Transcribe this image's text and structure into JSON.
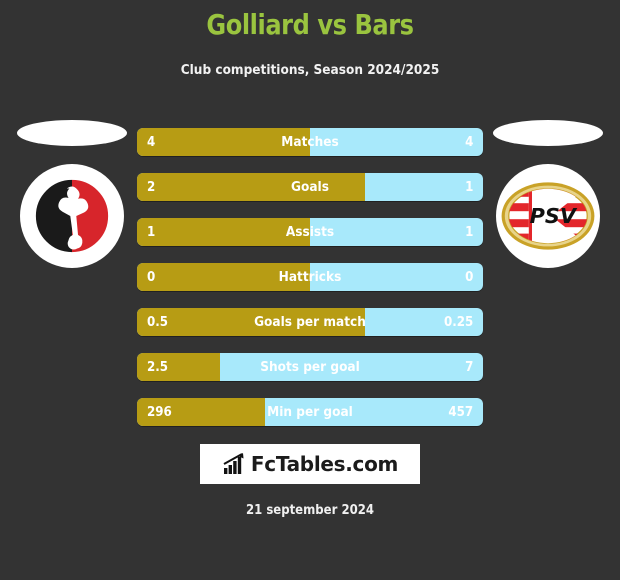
{
  "header": {
    "title": "Golliard vs Bars",
    "subtitle": "Club competitions, Season 2024/2025",
    "title_color": "#9ac43f"
  },
  "teams": {
    "home": {
      "badge_icon": "club-badge-red-black-icon"
    },
    "away": {
      "badge_icon": "psv-badge-icon",
      "badge_text": "PSV"
    }
  },
  "colors": {
    "home_bar": "#b79c14",
    "away_bar": "#a8e9fb",
    "background": "#333333"
  },
  "footer": {
    "logo_text": "FcTables.com",
    "logo_icon": "bar-chart-arrow-icon",
    "date": "21 september 2024"
  },
  "chart_data": {
    "type": "bar",
    "title": "Golliard vs Bars",
    "subtitle": "Club competitions, Season 2024/2025",
    "orientation": "horizontal-diverging",
    "series": [
      {
        "name": "Golliard",
        "color": "#b79c14"
      },
      {
        "name": "Bars",
        "color": "#a8e9fb"
      }
    ],
    "categories": [
      "Matches",
      "Goals",
      "Assists",
      "Hattricks",
      "Goals per match",
      "Shots per goal",
      "Min per goal"
    ],
    "rows": [
      {
        "label": "Matches",
        "home": "4",
        "away": "4",
        "home_pct": 50
      },
      {
        "label": "Goals",
        "home": "2",
        "away": "1",
        "home_pct": 66
      },
      {
        "label": "Assists",
        "home": "1",
        "away": "1",
        "home_pct": 50
      },
      {
        "label": "Hattricks",
        "home": "0",
        "away": "0",
        "home_pct": 50
      },
      {
        "label": "Goals per match",
        "home": "0.5",
        "away": "0.25",
        "home_pct": 66
      },
      {
        "label": "Shots per goal",
        "home": "2.5",
        "away": "7",
        "home_pct": 24
      },
      {
        "label": "Min per goal",
        "home": "296",
        "away": "457",
        "home_pct": 37
      }
    ]
  }
}
